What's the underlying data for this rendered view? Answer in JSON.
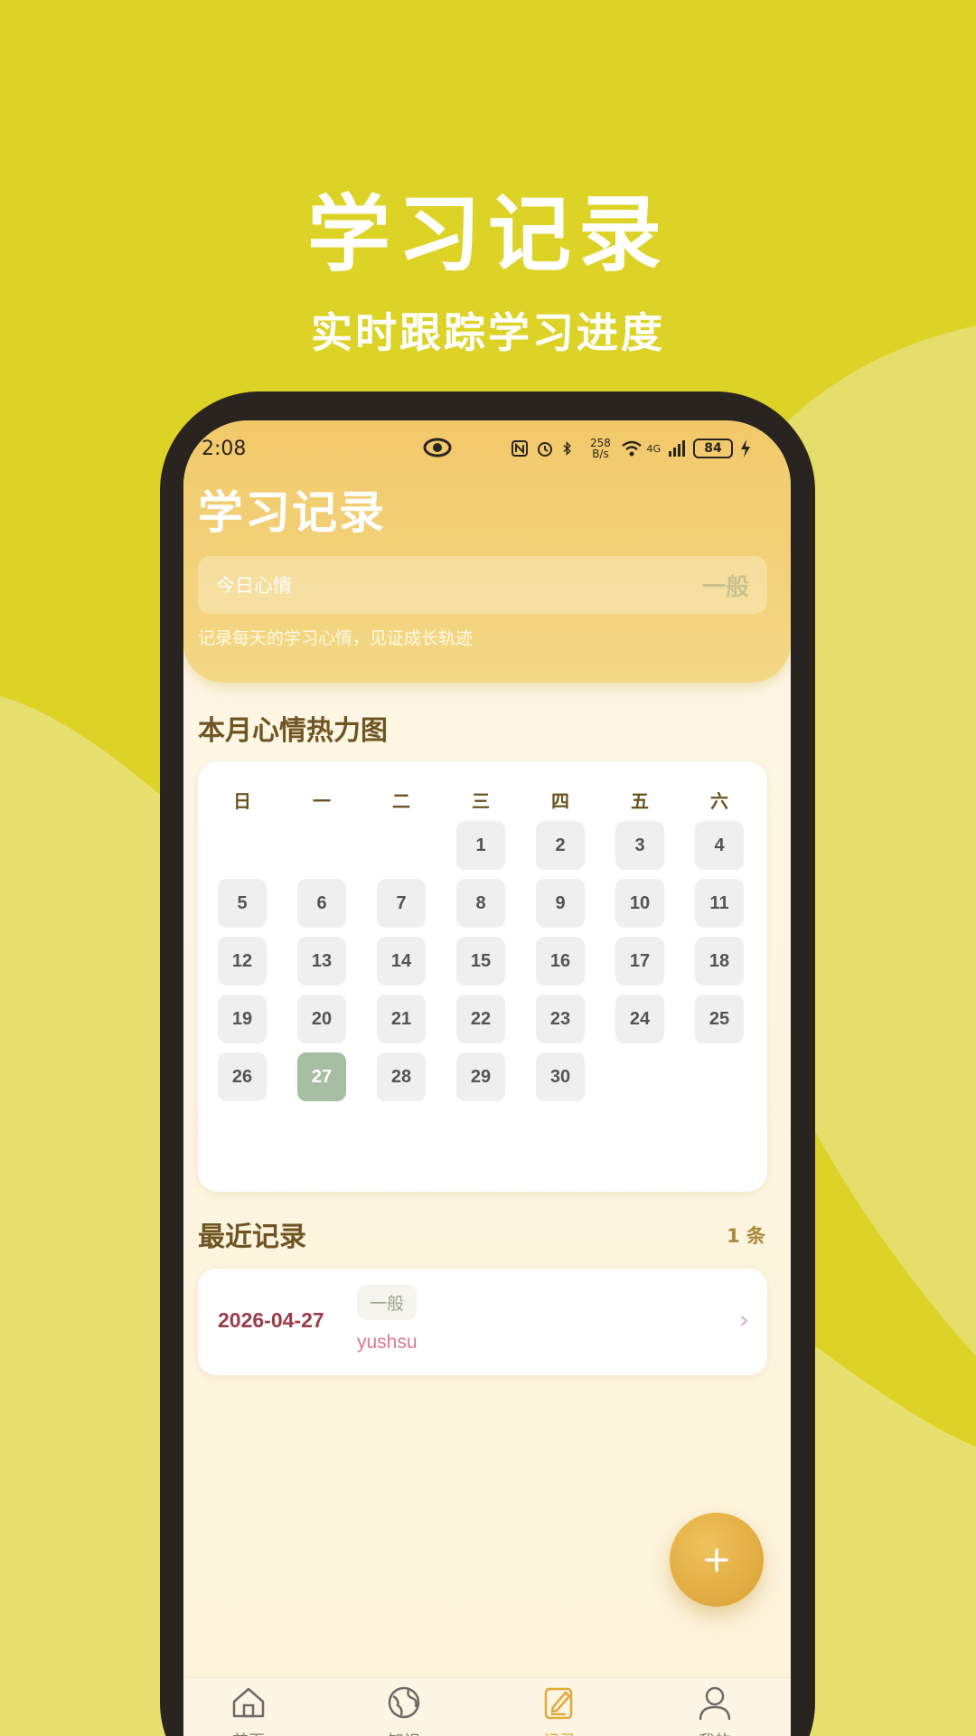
{
  "promo": {
    "title": "学习记录",
    "subtitle": "实时跟踪学习进度"
  },
  "status_bar": {
    "time": "2:08",
    "net_speed": "258 B/s",
    "signal": "4G",
    "battery": "84"
  },
  "header": {
    "title": "学习记录",
    "mood_label": "今日心情",
    "mood_value": "一般",
    "hint": "记录每天的学习心情，见证成长轨迹"
  },
  "heatmap": {
    "title": "本月心情热力图",
    "weekdays": [
      "日",
      "一",
      "二",
      "三",
      "四",
      "五",
      "六"
    ],
    "days": [
      "1",
      "2",
      "3",
      "4",
      "5",
      "6",
      "7",
      "8",
      "9",
      "10",
      "11",
      "12",
      "13",
      "14",
      "15",
      "16",
      "17",
      "18",
      "19",
      "20",
      "21",
      "22",
      "23",
      "24",
      "25",
      "26",
      "27",
      "28",
      "29",
      "30"
    ],
    "first_weekday_index": 3,
    "today": "27"
  },
  "recent": {
    "title": "最近记录",
    "count": "1 条",
    "records": [
      {
        "date": "2026-04-27",
        "mood": "一般",
        "user": "yushsu"
      }
    ]
  },
  "fab": {
    "label": "+"
  },
  "tabs": [
    {
      "label": "首页",
      "icon": "home-icon"
    },
    {
      "label": "知识",
      "icon": "globe-icon"
    },
    {
      "label": "记录",
      "icon": "edit-note-icon",
      "active": true
    },
    {
      "label": "我的",
      "icon": "user-icon"
    }
  ],
  "colors": {
    "background": "#ddd226",
    "header": "#f2c96a",
    "accent": "#e0a93a",
    "today": "#a6bfa2",
    "record_date": "#9c3b4a"
  }
}
